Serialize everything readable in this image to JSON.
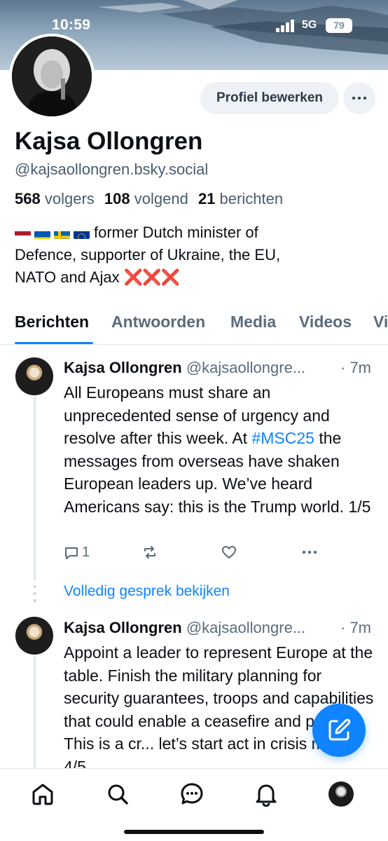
{
  "status_bar": {
    "time": "10:59",
    "network": "5G",
    "battery": "79"
  },
  "profile": {
    "edit_button": "Profiel bewerken",
    "name": "Kajsa Ollongren",
    "handle": "@kajsaollongren.bsky.social",
    "stats": {
      "followers_count": "568",
      "followers_label": "volgers",
      "following_count": "108",
      "following_label": "volgend",
      "posts_count": "21",
      "posts_label": "berichten"
    },
    "bio_text_1": "former Dutch minister of",
    "bio_text_2": "Defence, supporter of Ukraine, the EU,",
    "bio_text_3": "NATO and Ajax",
    "bio_marks": "❌❌❌"
  },
  "tabs": [
    "Berichten",
    "Antwoorden",
    "Media",
    "Videos",
    "Vi"
  ],
  "posts": [
    {
      "author": "Kajsa Ollongren",
      "handle": "@kajsaollongre...",
      "time": "· 7m",
      "text_before": "All Europeans must share an unprecedented sense of urgency and resolve after this week. At ",
      "hashtag": "#MSC25",
      "text_after": " the messages from overseas have shaken European leaders up. We’ve heard Americans say: this is the Trump world. 1/5",
      "reply_count": "1"
    },
    {
      "author": "Kajsa Ollongren",
      "handle": "@kajsaollongre...",
      "time": "· 7m",
      "text": "Appoint a leader to represent Europe at the table. Finish the military planning for security guarantees, troops and capabilities that could enable a ceasefire and peace. This is a cr... let’s start act in crisis mode. 4/5"
    }
  ],
  "view_conversation": "Volledig gesprek bekijken",
  "icons": {
    "nav": [
      "home-icon",
      "search-icon",
      "chat-icon",
      "bell-icon",
      "profile-avatar"
    ],
    "fab": "compose-icon"
  },
  "colors": {
    "accent": "#1083fe",
    "danger": "#d11a22"
  }
}
